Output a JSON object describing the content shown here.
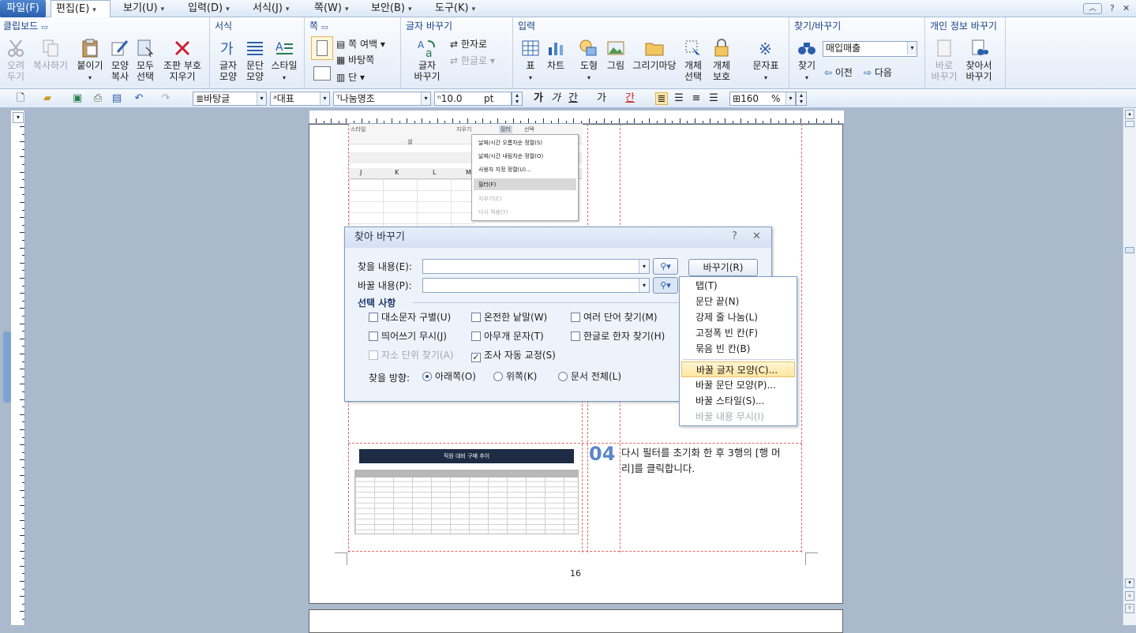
{
  "menubar": {
    "tabs": [
      "파일(F)",
      "편집(E)",
      "보기(U)",
      "입력(D)",
      "서식(J)",
      "쪽(W)",
      "보안(B)",
      "도구(K)"
    ],
    "active": "편집(E)"
  },
  "ribbon": {
    "groups": {
      "clipboard": {
        "title": "클립보드",
        "cut": "오려\n두기",
        "copy": "복사하기",
        "paste": "붙이기",
        "format_copy": "모양\n복사",
        "select_all": "모두\n선택",
        "clear_code": "조판 부호\n지우기"
      },
      "format": {
        "title": "서식",
        "char_shape": "글자\n모양",
        "para_shape": "문단\n모양",
        "style": "스타일"
      },
      "page": {
        "title": "쪽",
        "margin": "쪽 여백",
        "background": "바탕쪽",
        "columns": "단"
      },
      "convert": {
        "title": "글자 바꾸기",
        "convert_btn": "글자\n바꾸기",
        "hanja": "한자로",
        "hangul": "한글로"
      },
      "insert": {
        "title": "입력",
        "table": "표",
        "chart": "차트",
        "shape": "도형",
        "picture": "그림",
        "gallery": "그리기마당",
        "obj_select": "개체\n선택",
        "obj_protect": "개체\n보호",
        "symbol": "문자표"
      },
      "find": {
        "title": "찾기/바꾸기",
        "find_btn": "찾기",
        "search_value": "매입매출",
        "prev": "이전",
        "next": "다음"
      },
      "privacy": {
        "title": "개인 정보 바꾸기",
        "replace": "바로\n바꾸기",
        "find_replace": "찾아서\n바꾸기"
      }
    }
  },
  "toolbar": {
    "style_box": "바탕글",
    "lang_box": "대표",
    "font_box": "나눔명조",
    "size_box": "10.0",
    "size_unit": "pt",
    "bold": "가",
    "italic": "가",
    "underline": "간",
    "strike": "가",
    "color": "간",
    "zoom": "160",
    "zoom_unit": "%"
  },
  "excel": {
    "ribbon_text": [
      "스타일",
      "셀",
      "지우기",
      "필터",
      "선택"
    ],
    "cols": [
      "J",
      "K",
      "L",
      "M"
    ],
    "menu": [
      "날짜/시간 오름차순 정렬(S)",
      "날짜/시간 내림차순 정렬(O)",
      "사용자 지정 정렬(U)...",
      "필터(F)",
      "지우기(C)",
      "다시 적용(Y)"
    ]
  },
  "dialog": {
    "title": "찾아 바꾸기",
    "find_label": "찾을 내용(E):",
    "replace_label": "바꿀 내용(P):",
    "replace_button": "바꾸기(R)",
    "options_title": "선택 사항",
    "options": [
      {
        "label": "대소문자 구별(U)",
        "checked": false,
        "disabled": false
      },
      {
        "label": "온전한 낱말(W)",
        "checked": false,
        "disabled": false
      },
      {
        "label": "여러 단어 찾기(M)",
        "checked": false,
        "disabled": false
      },
      {
        "label": "띄어쓰기 무시(J)",
        "checked": false,
        "disabled": false
      },
      {
        "label": "아무개 문자(T)",
        "checked": false,
        "disabled": false
      },
      {
        "label": "한글로 한자 찾기(H)",
        "checked": false,
        "disabled": false
      },
      {
        "label": "자소 단위 찾기(A)",
        "checked": false,
        "disabled": true
      },
      {
        "label": "조사 자동 교정(S)",
        "checked": true,
        "disabled": false
      }
    ],
    "direction_label": "찾을 방향:",
    "directions": [
      {
        "label": "아래쪽(O)",
        "selected": true
      },
      {
        "label": "위쪽(K)",
        "selected": false
      },
      {
        "label": "문서 전체(L)",
        "selected": false
      }
    ],
    "help": "?",
    "close": "✕"
  },
  "popup_menu": {
    "items": [
      {
        "label": "탭(T)",
        "disabled": false,
        "highlight": false
      },
      {
        "label": "문단 끝(N)",
        "disabled": false,
        "highlight": false
      },
      {
        "label": "강제 줄 나눔(L)",
        "disabled": false,
        "highlight": false
      },
      {
        "label": "고정폭 빈 칸(F)",
        "disabled": false,
        "highlight": false
      },
      {
        "label": "묶음 빈 칸(B)",
        "disabled": false,
        "highlight": false
      },
      {
        "label": "바꿀 글자 모양(C)...",
        "disabled": false,
        "highlight": true
      },
      {
        "label": "바꿀 문단 모양(P)...",
        "disabled": false,
        "highlight": false
      },
      {
        "label": "바꿀 스타일(S)...",
        "disabled": false,
        "highlight": false
      },
      {
        "label": "바꿀 내용 무시(I)",
        "disabled": true,
        "highlight": false
      }
    ]
  },
  "document": {
    "step_number": "04",
    "line1": "다시 필터를 초기화 한 후 3행의 [행 머",
    "line2": "리]를 클릭합니다.",
    "page_number": "16",
    "thumb_title": "직원 대비 구매 추이"
  },
  "colors": {
    "accent": "#2a5fae",
    "step": "#5a86c8",
    "dashed": "#e06a6a"
  }
}
